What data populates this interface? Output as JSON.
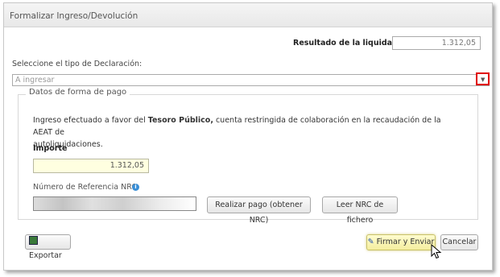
{
  "dialog": {
    "title": "Formalizar Ingreso/Devolución"
  },
  "result": {
    "label": "Resultado de la liquidación",
    "value": "1.312,05"
  },
  "declaration": {
    "label": "Seleccione el tipo de Declaración:",
    "selected": "A ingresar"
  },
  "payment": {
    "legend": "Datos de forma de pago",
    "desc_prefix": "Ingreso efectuado a favor del ",
    "desc_bold": "Tesoro Público,",
    "desc_line1_rest": " cuenta restringida de colaboración en la recaudación de la AEAT de",
    "desc_line2": "autoliquidaciones.",
    "importe_label": "Importe",
    "importe_value": "1.312,05",
    "nrc_label": "Número de Referencia  NRC:",
    "nrc_value": "",
    "realizar_pago_label": "Realizar pago (obtener NRC)",
    "leer_nrc_label": "Leer NRC de fichero"
  },
  "footer": {
    "export_label": "Exportar",
    "sign_label": "Firmar y Enviar",
    "cancel_label": "Cancelar"
  },
  "icons": {
    "export": "export-icon",
    "sign": "sign-icon",
    "info": "info-icon",
    "dropdown": "chevron-down-icon",
    "cursor": "mouse-pointer-icon"
  }
}
